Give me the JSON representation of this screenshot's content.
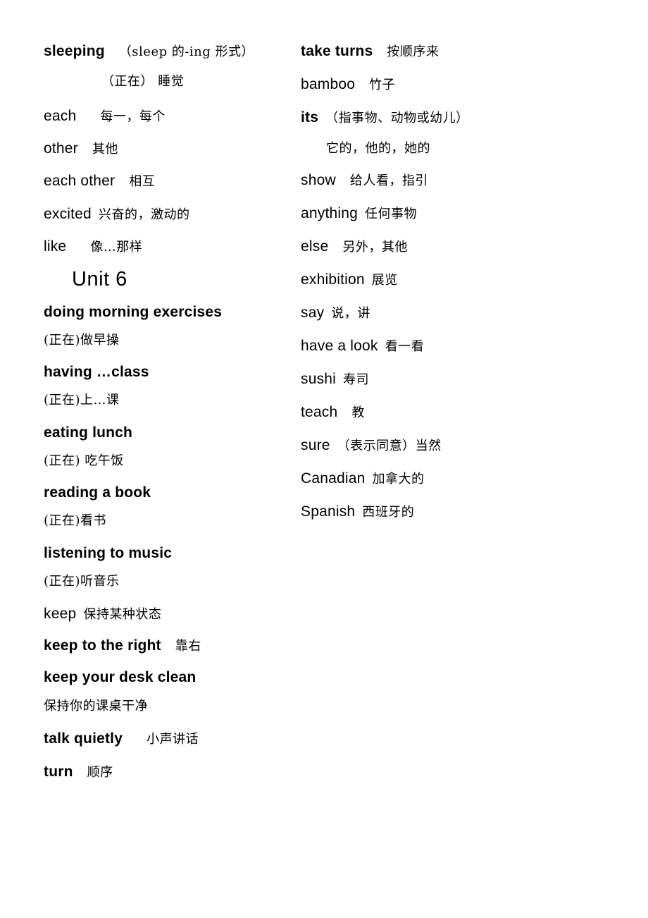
{
  "document": {
    "type": "vocabulary-list",
    "language_pair": "English-Chinese",
    "columns": 2
  },
  "left_column": {
    "entries": [
      {
        "id": "sleeping",
        "term": "sleeping",
        "term_weight": "bold",
        "gloss_en": "（sleep 的-ing 形式）",
        "continuation": "（正在） 睡觉"
      },
      {
        "id": "each",
        "term": "each",
        "term_weight": "regular",
        "gloss": "每一，每个"
      },
      {
        "id": "other",
        "term": "other",
        "term_weight": "regular",
        "gloss": "其他"
      },
      {
        "id": "each-other",
        "term": "each other",
        "term_weight": "regular",
        "gloss": "相互"
      },
      {
        "id": "excited",
        "term": "excited",
        "term_weight": "regular",
        "gloss": "兴奋的，激动的"
      },
      {
        "id": "like",
        "term": "like",
        "term_weight": "regular",
        "gloss": "像…那样"
      }
    ],
    "unit_heading": "Unit 6",
    "unit_entries": [
      {
        "id": "doing-morning-exercises",
        "term": "doing morning exercises",
        "term_weight": "bold",
        "gloss_line": "(正在)做早操"
      },
      {
        "id": "having-class",
        "term": "having …class",
        "term_weight": "bold",
        "gloss_line": "(正在)上…课"
      },
      {
        "id": "eating-lunch",
        "term": "eating lunch",
        "term_weight": "bold",
        "gloss_line": "(正在) 吃午饭"
      },
      {
        "id": "reading-a-book",
        "term": "reading a book",
        "term_weight": "bold",
        "gloss_line": "(正在)看书"
      },
      {
        "id": "listening-to-music",
        "term": "listening to music",
        "term_weight": "bold",
        "gloss_line": "(正在)听音乐"
      },
      {
        "id": "keep",
        "term": "keep",
        "term_weight": "regular",
        "gloss": "保持某种状态"
      },
      {
        "id": "keep-to-the-right",
        "term": "keep to the right",
        "term_weight": "bold",
        "gloss": "靠右"
      },
      {
        "id": "keep-your-desk-clean",
        "term": "keep your desk clean",
        "term_weight": "bold",
        "gloss_line": "保持你的课桌干净"
      },
      {
        "id": "talk-quietly",
        "term": "talk quietly",
        "term_weight": "bold",
        "gloss": "小声讲话"
      },
      {
        "id": "turn",
        "term": "turn",
        "term_weight": "bold",
        "gloss": "顺序"
      }
    ]
  },
  "right_column": {
    "entries": [
      {
        "id": "take-turns",
        "term": "take turns",
        "term_weight": "bold",
        "gloss": "按顺序来"
      },
      {
        "id": "bamboo",
        "term": "bamboo",
        "term_weight": "regular",
        "gloss": "竹子"
      },
      {
        "id": "its",
        "term": "its",
        "term_weight": "bold",
        "gloss": "（指事物、动物或幼儿）",
        "continuation": "它的，他的，她的"
      },
      {
        "id": "show",
        "term": "show",
        "term_weight": "regular",
        "gloss": "给人看，指引"
      },
      {
        "id": "anything",
        "term": "anything",
        "term_weight": "regular",
        "gloss": "任何事物"
      },
      {
        "id": "else",
        "term": "else",
        "term_weight": "regular",
        "gloss": "另外，其他"
      },
      {
        "id": "exhibition",
        "term": "exhibition",
        "term_weight": "regular",
        "gloss": "展览"
      },
      {
        "id": "say",
        "term": "say",
        "term_weight": "regular",
        "gloss": "说，讲"
      },
      {
        "id": "have-a-look",
        "term": "have a look",
        "term_weight": "regular",
        "gloss": "看一看"
      },
      {
        "id": "sushi",
        "term": "sushi",
        "term_weight": "regular",
        "gloss": "寿司"
      },
      {
        "id": "teach",
        "term": "teach",
        "term_weight": "regular",
        "gloss": "教"
      },
      {
        "id": "sure",
        "term": "sure",
        "term_weight": "regular",
        "gloss": "（表示同意）当然"
      },
      {
        "id": "canadian",
        "term": "Canadian",
        "term_weight": "regular",
        "gloss": "加拿大的"
      },
      {
        "id": "spanish",
        "term": "Spanish",
        "term_weight": "regular",
        "gloss": "西班牙的"
      }
    ]
  }
}
